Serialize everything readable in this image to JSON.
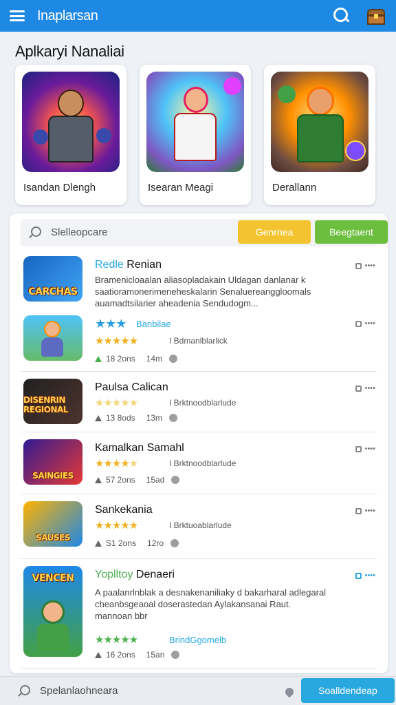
{
  "app_bar": {
    "title": "Inaplarsan",
    "menu_icon": "hamburger-menu-icon",
    "search_icon": "search-icon",
    "chest_icon": "treasure-chest-icon",
    "color": "#1e88e5"
  },
  "featured": {
    "title": "Aplkaryi Nanaliai",
    "items": [
      {
        "name": "Isandan Dlengh"
      },
      {
        "name": "Isearan Meagi"
      },
      {
        "name": "Derallann"
      }
    ]
  },
  "filter": {
    "placeholder": "Slelleopcare",
    "button_yellow": "Genrnea",
    "button_green": "Beegtaent"
  },
  "apps": [
    {
      "title_accent": "Redle",
      "title_rest": " Renian",
      "banner": "CARCHAS",
      "desc": "Bramenicloaalan aliasopladakain Uldagan danlanar k saatioramonerimeneheskalarin Senaluereanggloomals auamadtsilarier aheadenia Sendudogm...",
      "side": "••••"
    },
    {
      "title_accent": "",
      "title_rest": "",
      "banner": "",
      "rating_text": "Banbilae",
      "rating_text2": "I Bdmanlblarlick",
      "meta_count": "18 2ons",
      "meta_time": "14m",
      "side": "••••"
    },
    {
      "title_rest": "Paulsa Calican",
      "banner": "DISENRIN REGIONAL",
      "rating_text": "I Brktnoodblarlude",
      "meta_count": "13 8ods",
      "meta_time": "13m",
      "side": "••••"
    },
    {
      "title_rest": "Kamalkan Samahl",
      "banner": "SAINGIES",
      "rating_text": "I Brktnoodblarlude",
      "meta_count": "57 2ons",
      "meta_time": "15ad",
      "side": "••••"
    },
    {
      "title_rest": "Sankekania",
      "banner": "SAUSES",
      "rating_text": "I Brktuoablarlude",
      "meta_count": "S1 2ons",
      "meta_time": "12ro",
      "side": "••••"
    },
    {
      "title_accent_g": "Yoplltoy",
      "title_rest": " Denaeri",
      "banner": "VENCEN",
      "desc": "A paalanrlnblak a desnakenaniliaky d bakarharal adlegaral cheanbsgeaoal doserastedan Aylakansanai Raut. mannoan bbr",
      "rating_text": "BrindGgomelb",
      "meta_count": "16 2ons",
      "meta_time": "15an",
      "side": "••••"
    }
  ],
  "bottom_bar": {
    "placeholder": "Spelanlaohneara",
    "button": "Soalldendeap"
  }
}
